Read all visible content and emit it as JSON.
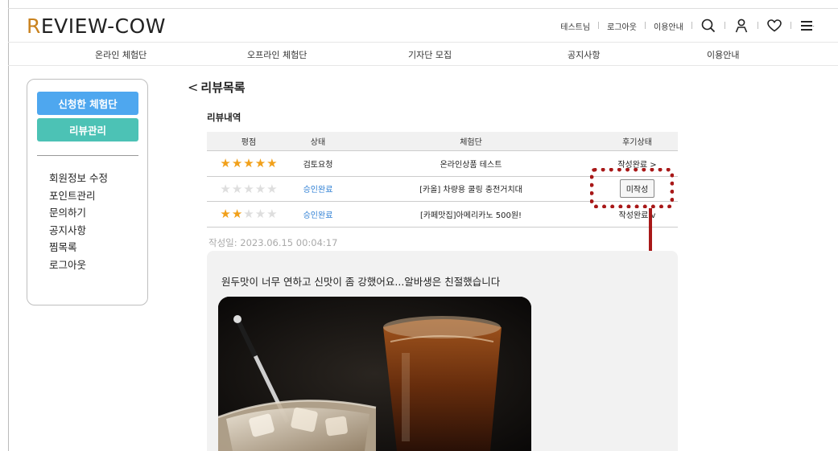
{
  "brand": {
    "logo_first": "R",
    "logo_rest": "EVIEW-COW",
    "accent": "#c9821e"
  },
  "top_links": {
    "user": "테스트님",
    "logout": "로그아웃",
    "guide": "이용안내"
  },
  "icons": [
    "search-icon",
    "user-icon",
    "heart-icon",
    "menu-icon"
  ],
  "nav": [
    "온라인 체험단",
    "오프라인 체험단",
    "기자단 모집",
    "공지사항",
    "이용안내"
  ],
  "sidebar": {
    "primary_button": "신청한 체험단",
    "secondary_button": "리뷰관리",
    "items": [
      "회원정보 수정",
      "포인트관리",
      "문의하기",
      "공지사항",
      "찜목록",
      "로그아웃"
    ],
    "colors": {
      "primary": "#4ea7ef",
      "secondary": "#4cc2b5"
    }
  },
  "page": {
    "back_title": "리뷰목록",
    "section_title": "리뷰내역"
  },
  "table": {
    "headers": [
      "평점",
      "상태",
      "체험단",
      "후기상태"
    ],
    "rows": [
      {
        "rating": 5,
        "status": "검토요청",
        "campaign": "온라인상품 테스트",
        "review_status": "작성완료 >"
      },
      {
        "rating": 0,
        "status": "승인완료",
        "campaign": "[카올] 차량용 쿨링 충전거치대",
        "review_status": "미작성"
      },
      {
        "rating": 2,
        "status": "승인완료",
        "campaign": "[카페맛집]아메리카노 500원!",
        "review_status": "작성완료 v"
      }
    ]
  },
  "review": {
    "date": "작성일: 2023.06.15 00:04:17",
    "text": "원두맛이 너무 연하고 신맛이 좀 강했어요...알바생은 친절했습니다"
  },
  "highlight_color": "#a81818"
}
